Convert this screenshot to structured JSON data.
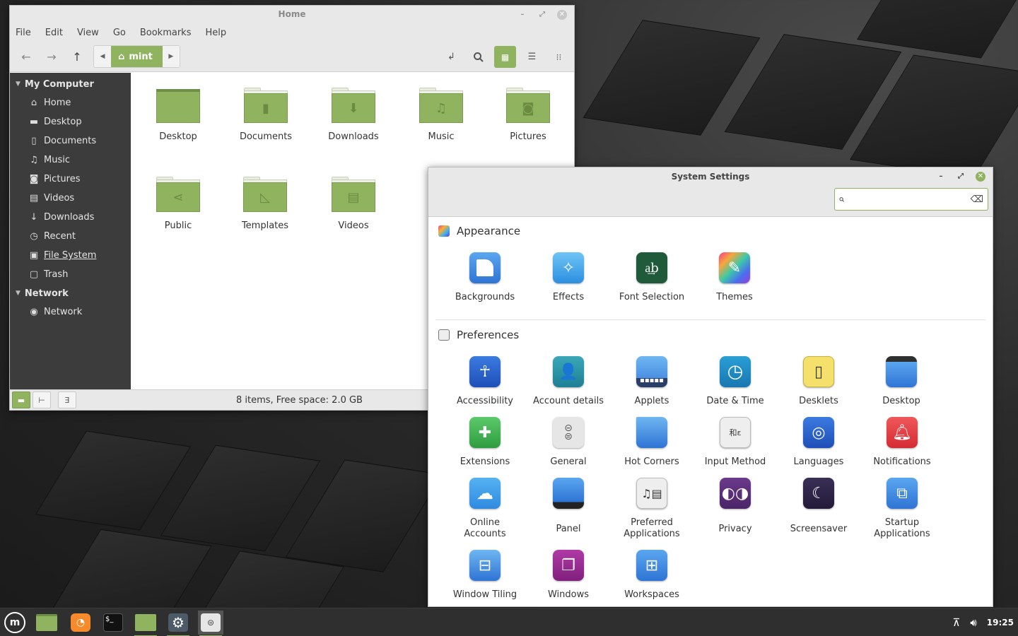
{
  "colors": {
    "accent": "#8fb35e",
    "sidebar": "#3c3c3c",
    "taskbar": "#2f2f2f"
  },
  "file_manager": {
    "title": "Home",
    "menu": [
      "File",
      "Edit",
      "View",
      "Go",
      "Bookmarks",
      "Help"
    ],
    "path_crumb": "mint",
    "sidebar": {
      "my_computer": "My Computer",
      "items": [
        {
          "label": "Home",
          "icon": "home-icon"
        },
        {
          "label": "Desktop",
          "icon": "desktop-icon"
        },
        {
          "label": "Documents",
          "icon": "document-icon"
        },
        {
          "label": "Music",
          "icon": "music-icon"
        },
        {
          "label": "Pictures",
          "icon": "camera-icon"
        },
        {
          "label": "Videos",
          "icon": "film-icon"
        },
        {
          "label": "Downloads",
          "icon": "download-icon"
        },
        {
          "label": "Recent",
          "icon": "clock-icon"
        },
        {
          "label": "File System",
          "icon": "drive-icon"
        },
        {
          "label": "Trash",
          "icon": "trash-icon"
        }
      ],
      "network_head": "Network",
      "network_items": [
        {
          "label": "Network",
          "icon": "globe-icon"
        }
      ]
    },
    "files": [
      {
        "label": "Desktop"
      },
      {
        "label": "Documents"
      },
      {
        "label": "Downloads"
      },
      {
        "label": "Music"
      },
      {
        "label": "Pictures"
      },
      {
        "label": "Public"
      },
      {
        "label": "Templates"
      },
      {
        "label": "Videos"
      }
    ],
    "status": "8 items, Free space: 2.0 GB"
  },
  "system_settings": {
    "title": "System Settings",
    "search_value": "",
    "appearance": {
      "heading": "Appearance",
      "items": [
        {
          "label": "Backgrounds",
          "icon": "backgrounds-icon"
        },
        {
          "label": "Effects",
          "icon": "effects-icon"
        },
        {
          "label": "Font Selection",
          "icon": "font-selection-icon"
        },
        {
          "label": "Themes",
          "icon": "themes-icon"
        }
      ]
    },
    "preferences": {
      "heading": "Preferences",
      "items": [
        {
          "label": "Accessibility",
          "icon": "accessibility-icon"
        },
        {
          "label": "Account details",
          "icon": "account-icon"
        },
        {
          "label": "Applets",
          "icon": "applets-icon"
        },
        {
          "label": "Date & Time",
          "icon": "clock-icon"
        },
        {
          "label": "Desklets",
          "icon": "desklets-icon"
        },
        {
          "label": "Desktop",
          "icon": "desktop-icon"
        },
        {
          "label": "Extensions",
          "icon": "puzzle-icon"
        },
        {
          "label": "General",
          "icon": "toggles-icon"
        },
        {
          "label": "Hot Corners",
          "icon": "hot-corners-icon"
        },
        {
          "label": "Input Method",
          "icon": "input-method-icon"
        },
        {
          "label": "Languages",
          "icon": "globe-icon"
        },
        {
          "label": "Notifications",
          "icon": "bell-icon"
        },
        {
          "label": "Online Accounts",
          "icon": "cloud-icon"
        },
        {
          "label": "Panel",
          "icon": "panel-icon"
        },
        {
          "label": "Preferred Applications",
          "icon": "preferred-apps-icon"
        },
        {
          "label": "Privacy",
          "icon": "mask-icon"
        },
        {
          "label": "Screensaver",
          "icon": "moon-icon"
        },
        {
          "label": "Startup Applications",
          "icon": "startup-icon"
        },
        {
          "label": "Window Tiling",
          "icon": "tiling-icon"
        },
        {
          "label": "Windows",
          "icon": "windows-icon"
        },
        {
          "label": "Workspaces",
          "icon": "workspaces-icon"
        }
      ]
    }
  },
  "taskbar": {
    "clock": "19:25",
    "launchers": [
      {
        "name": "menu-button",
        "icon": "mint-logo-icon"
      },
      {
        "name": "show-desktop-button",
        "icon": "desktop-icon"
      },
      {
        "name": "firefox-launcher",
        "icon": "firefox-icon"
      },
      {
        "name": "terminal-launcher",
        "icon": "terminal-icon"
      },
      {
        "name": "files-launcher",
        "icon": "folder-icon"
      },
      {
        "name": "settings-window-button",
        "icon": "gear-icon"
      },
      {
        "name": "system-settings-window-button",
        "icon": "toggles-icon"
      }
    ]
  }
}
